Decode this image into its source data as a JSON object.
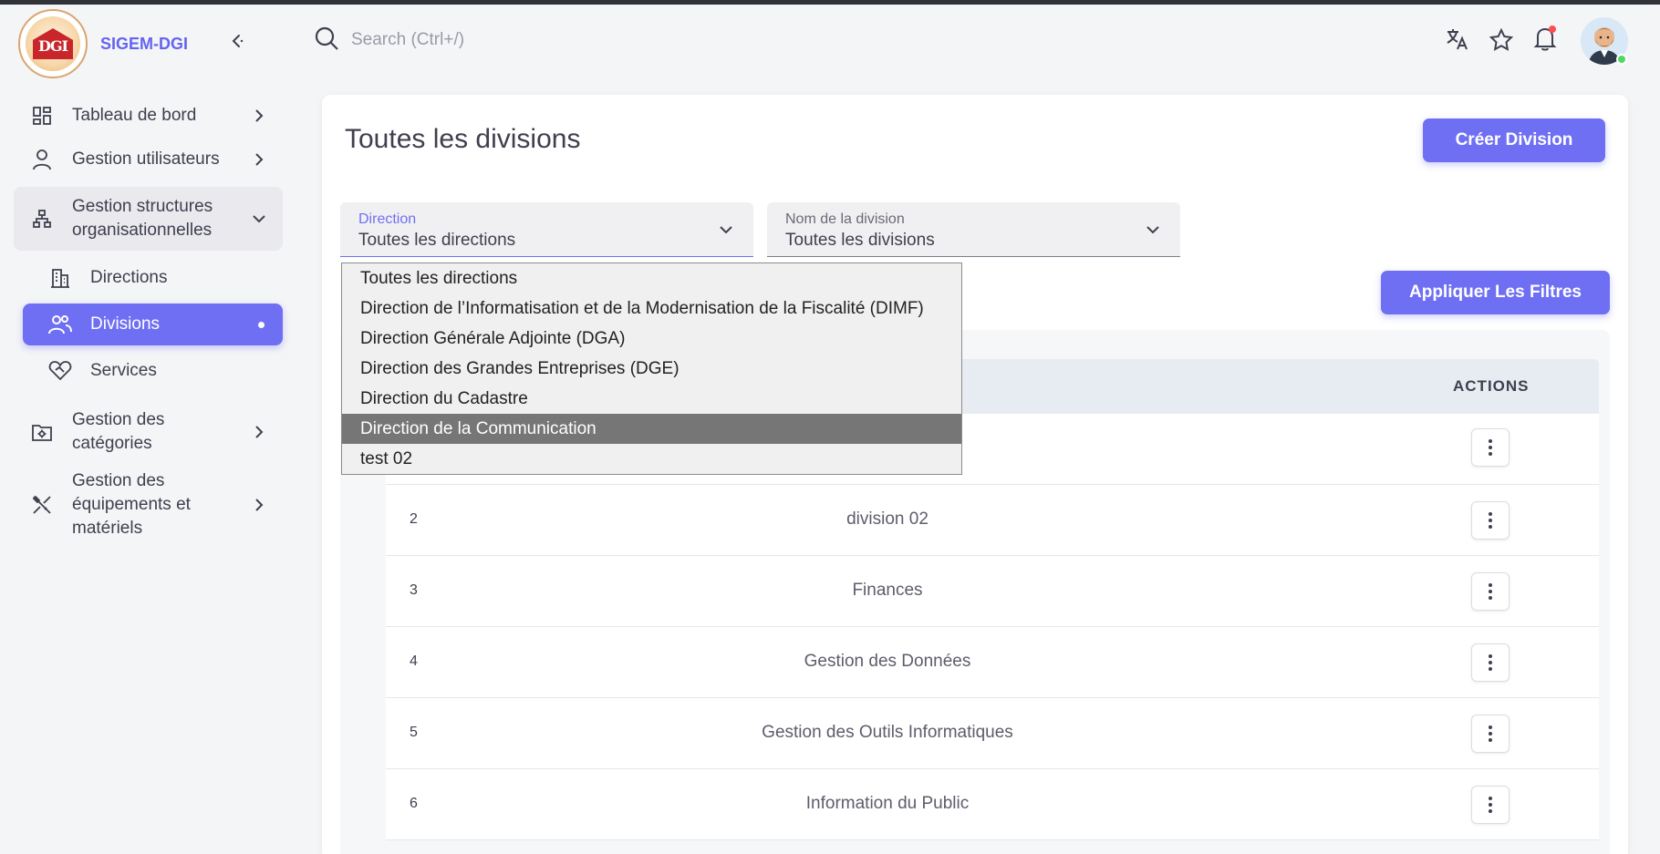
{
  "brand": {
    "name": "SIGEM-DGI",
    "logo_text": "DGI"
  },
  "search": {
    "placeholder": "Search (Ctrl+/)"
  },
  "sidebar": {
    "items": [
      {
        "label": "Tableau de bord",
        "icon": "dashboard-icon"
      },
      {
        "label": "Gestion utilisateurs",
        "icon": "user-icon"
      },
      {
        "label_line1": "Gestion structures",
        "label_line2": "organisationnelles",
        "icon": "hierarchy-icon"
      },
      {
        "label_line1": "Gestion des",
        "label_line2": "catégories",
        "icon": "folder-settings-icon"
      },
      {
        "label_line1": "Gestion des",
        "label_line2": "équipements et",
        "label_line3": "matériels",
        "icon": "tools-icon"
      }
    ],
    "subitems": [
      {
        "label": "Directions",
        "icon": "building-icon"
      },
      {
        "label": "Divisions",
        "icon": "users-icon",
        "active": true
      },
      {
        "label": "Services",
        "icon": "heart-handshake-icon"
      }
    ]
  },
  "page": {
    "title": "Toutes les divisions",
    "create_button": "Créer Division",
    "apply_button": "Appliquer Les Filtres"
  },
  "filters": {
    "direction": {
      "label": "Direction",
      "value": "Toutes les directions"
    },
    "division": {
      "label": "Nom de la division",
      "value": "Toutes les divisions"
    }
  },
  "dropdown": {
    "options": [
      "Toutes les directions",
      "Direction de l’Informatisation et de la Modernisation de la Fiscalité (DIMF)",
      "Direction Générale Adjointe (DGA)",
      "Direction des Grandes Entreprises (DGE)",
      "Direction du Cadastre",
      "Direction de la Communication",
      "test 02"
    ],
    "highlighted": "Direction de la Communication"
  },
  "table": {
    "actions_header": "ACTIONS",
    "rows": [
      {
        "num": "2",
        "name": "division 02"
      },
      {
        "num": "3",
        "name": "Finances"
      },
      {
        "num": "4",
        "name": "Gestion des Données"
      },
      {
        "num": "5",
        "name": "Gestion des Outils Informatiques"
      },
      {
        "num": "6",
        "name": "Information du Public"
      }
    ]
  },
  "colors": {
    "accent": "#6f6ff3",
    "notification": "#ff4c51",
    "online": "#4cd964"
  }
}
